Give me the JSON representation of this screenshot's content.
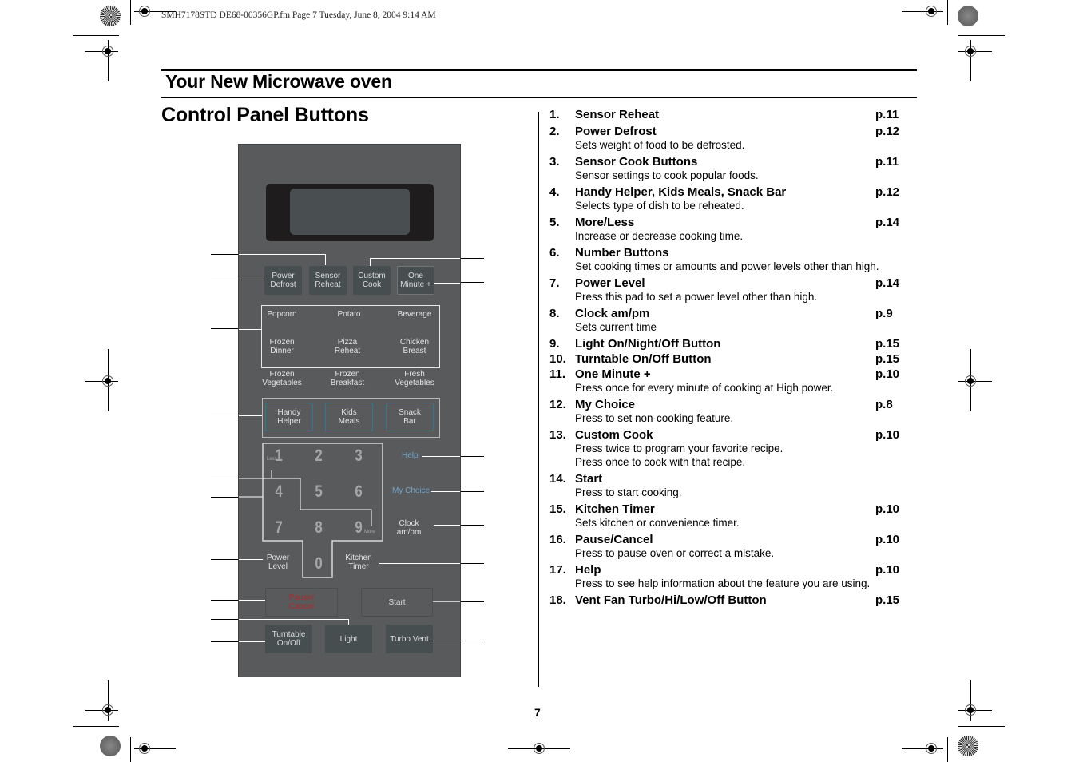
{
  "header_meta": "SMH7178STD DE68-00356GP.fm  Page 7  Tuesday, June 8, 2004  9:14 AM",
  "section_title": "Your New Microwave oven",
  "page_title": "Control Panel Buttons",
  "page_number": "7",
  "panel": {
    "top_buttons": [
      "Power\nDefrost",
      "Sensor\nReheat",
      "Custom\nCook",
      "One\nMinute +"
    ],
    "sensor_cook": [
      "Popcorn",
      "Potato",
      "Beverage",
      "Frozen\nDinner",
      "Pizza\nReheat",
      "Chicken\nBreast"
    ],
    "outside_labels": [
      "Frozen\nVegetables",
      "Frozen\nBreakfast",
      "Fresh\nVegetables"
    ],
    "reheat_buttons": [
      "Handy\nHelper",
      "Kids\nMeals",
      "Snack\nBar"
    ],
    "digits": [
      "1",
      "2",
      "3",
      "4",
      "5",
      "6",
      "7",
      "8",
      "9",
      "0"
    ],
    "less_label": "Less",
    "more_label": "More",
    "help": "Help",
    "my_choice": "My Choice",
    "clock": "Clock\nam/pm",
    "power_level": "Power\nLevel",
    "kitchen_timer": "Kitchen\nTimer",
    "pause_cancel": "Pause/\nCancel",
    "start": "Start",
    "turntable": "Turntable\nOn/Off",
    "light": "Light",
    "turbo_vent": "Turbo Vent",
    "colors": {
      "panel": "#595a5c",
      "teal": "#2b7b97",
      "help_blue": "#6fa5cc",
      "pause_red": "#b0292a"
    }
  },
  "items": [
    {
      "num": "1.",
      "title": "Sensor Reheat",
      "page": "p.11",
      "desc": []
    },
    {
      "num": "2.",
      "title": "Power Defrost",
      "page": "p.12",
      "desc": [
        "Sets weight of food to be defrosted."
      ]
    },
    {
      "num": "3.",
      "title": "Sensor Cook Buttons",
      "page": "p.11",
      "desc": [
        "Sensor settings to cook popular foods."
      ]
    },
    {
      "num": "4.",
      "title": "Handy Helper, Kids Meals, Snack Bar",
      "page": "p.12",
      "desc": [
        "Selects type of dish to be reheated."
      ]
    },
    {
      "num": "5.",
      "title": "More/Less",
      "page": "p.14",
      "desc": [
        "Increase or decrease cooking time."
      ]
    },
    {
      "num": "6.",
      "title": "Number Buttons",
      "page": "",
      "desc": [
        "Set cooking times or amounts and power levels other than high."
      ]
    },
    {
      "num": "7.",
      "title": "Power Level",
      "page": "p.14",
      "desc": [
        "Press this pad to set a power level other than high."
      ]
    },
    {
      "num": "8.",
      "title": "Clock am/pm",
      "page": "p.9",
      "desc": [
        "Sets current time"
      ]
    },
    {
      "num": "9.",
      "title": "Light On/Night/Off Button",
      "page": "p.15",
      "desc": []
    },
    {
      "num": "10.",
      "title": "Turntable On/Off Button",
      "page": "p.15",
      "desc": []
    },
    {
      "num": "11.",
      "title": "One Minute +",
      "page": "p.10",
      "desc": [
        "Press once for every minute of cooking at High power."
      ]
    },
    {
      "num": "12.",
      "title": "My Choice",
      "page": "p.8",
      "desc": [
        "Press to set non-cooking feature."
      ]
    },
    {
      "num": "13.",
      "title": "Custom Cook",
      "page": "p.10",
      "desc": [
        "Press twice to program your favorite recipe.",
        "Press once to cook with that recipe."
      ]
    },
    {
      "num": "14.",
      "title": "Start",
      "page": "",
      "desc": [
        "Press to start cooking."
      ]
    },
    {
      "num": "15.",
      "title": "Kitchen Timer",
      "page": "p.10",
      "desc": [
        "Sets kitchen or convenience timer."
      ]
    },
    {
      "num": "16.",
      "title": "Pause/Cancel",
      "page": "p.10",
      "desc": [
        "Press to pause oven or correct a mistake."
      ]
    },
    {
      "num": "17.",
      "title": "Help",
      "page": "p.10",
      "desc": [
        "Press to see help information about the feature you are using."
      ]
    },
    {
      "num": "18.",
      "title": "Vent Fan Turbo/Hi/Low/Off Button",
      "page": "p.15",
      "desc": []
    }
  ]
}
